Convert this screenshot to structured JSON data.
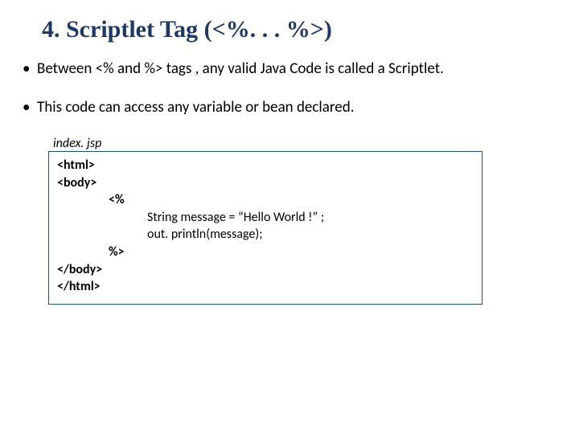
{
  "title": "4. Scriptlet Tag (<%. . .  %>)",
  "bullets": [
    "Between <%  and  %> tags , any valid Java Code is called a Scriptlet.",
    "This code can access any variable or bean declared."
  ],
  "code": {
    "filename": "index. jsp",
    "lines": {
      "l1": "<html>",
      "l2": "<body>",
      "l3": "<%",
      "l4": "String  message = “Hello World !” ;",
      "l5": "out. println(message);",
      "l6": "%>",
      "l7": "</body>",
      "l8": "</html>"
    }
  }
}
